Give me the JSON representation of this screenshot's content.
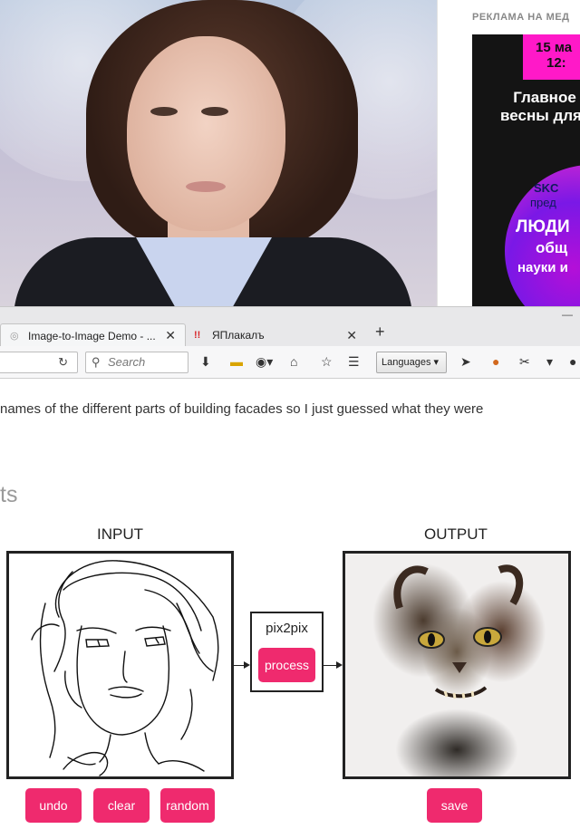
{
  "ad": {
    "label": "РЕКЛАМА НА МЕД",
    "date": [
      "15 ма",
      "12:"
    ],
    "headline": [
      "Главное",
      "весны для"
    ],
    "brand": "SKC",
    "brand_sub": "пред",
    "big": "ЛЮДИ",
    "line2": "общ",
    "line3": "науки и"
  },
  "browser": {
    "tabs": [
      {
        "title": "Image-to-Image Demo - ...",
        "icon": "globe-icon",
        "active": true
      },
      {
        "title": "ЯПлакалъ",
        "icon": "yaplakal-icon",
        "active": false
      }
    ],
    "new_tab": "+",
    "search_placeholder": "Search",
    "languages_button": "Languages ▾"
  },
  "page": {
    "paragraph": "names of the different parts of building facades so I just guessed what they were",
    "heading": "ts"
  },
  "demo": {
    "input_label": "INPUT",
    "output_label": "OUTPUT",
    "model_name": "pix2pix",
    "process_button": "process",
    "undo_button": "undo",
    "clear_button": "clear",
    "random_button": "random",
    "save_button": "save",
    "accent_color": "#ef2a6e"
  }
}
